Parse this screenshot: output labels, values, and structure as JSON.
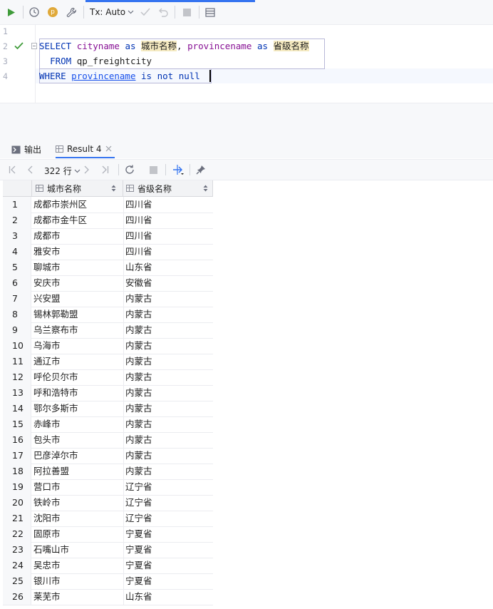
{
  "toolbar": {
    "tx_label": "Tx: Auto",
    "p_badge": "p",
    "accent": "#3574f0"
  },
  "editor": {
    "line_numbers": [
      "1",
      "2",
      "3",
      "4"
    ],
    "line2": {
      "kw_select": "SELECT",
      "col1": "cityname",
      "as1": "as",
      "alias1": "城市名称",
      "comma": ",",
      "col2": "provincename",
      "as2": "as",
      "alias2": "省级名称"
    },
    "line3": {
      "kw_from": "FROM",
      "table": "qp_freightcity"
    },
    "line4": {
      "kw_where": "WHERE",
      "col": "provincename",
      "rest": "is not null"
    }
  },
  "tabs": [
    {
      "label": "输出"
    },
    {
      "label": "Result 4"
    }
  ],
  "results_toolbar": {
    "row_count": "322 行"
  },
  "grid": {
    "columns": [
      "城市名称",
      "省级名称"
    ],
    "rows": [
      [
        "1",
        "成都市崇州区",
        "四川省"
      ],
      [
        "2",
        "成都市金牛区",
        "四川省"
      ],
      [
        "3",
        "成都市",
        "四川省"
      ],
      [
        "4",
        "雅安市",
        "四川省"
      ],
      [
        "5",
        "聊城市",
        "山东省"
      ],
      [
        "6",
        "安庆市",
        "安徽省"
      ],
      [
        "7",
        "兴安盟",
        "内蒙古"
      ],
      [
        "8",
        "锡林郭勒盟",
        "内蒙古"
      ],
      [
        "9",
        "乌兰察布市",
        "内蒙古"
      ],
      [
        "10",
        "乌海市",
        "内蒙古"
      ],
      [
        "11",
        "通辽市",
        "内蒙古"
      ],
      [
        "12",
        "呼伦贝尔市",
        "内蒙古"
      ],
      [
        "13",
        "呼和浩特市",
        "内蒙古"
      ],
      [
        "14",
        "鄂尔多斯市",
        "内蒙古"
      ],
      [
        "15",
        "赤峰市",
        "内蒙古"
      ],
      [
        "16",
        "包头市",
        "内蒙古"
      ],
      [
        "17",
        "巴彦淖尔市",
        "内蒙古"
      ],
      [
        "18",
        "阿拉善盟",
        "内蒙古"
      ],
      [
        "19",
        "营口市",
        "辽宁省"
      ],
      [
        "20",
        "铁岭市",
        "辽宁省"
      ],
      [
        "21",
        "沈阳市",
        "辽宁省"
      ],
      [
        "22",
        "固原市",
        "宁夏省"
      ],
      [
        "23",
        "石嘴山市",
        "宁夏省"
      ],
      [
        "24",
        "吴忠市",
        "宁夏省"
      ],
      [
        "25",
        "银川市",
        "宁夏省"
      ],
      [
        "26",
        "莱芜市",
        "山东省"
      ]
    ]
  }
}
